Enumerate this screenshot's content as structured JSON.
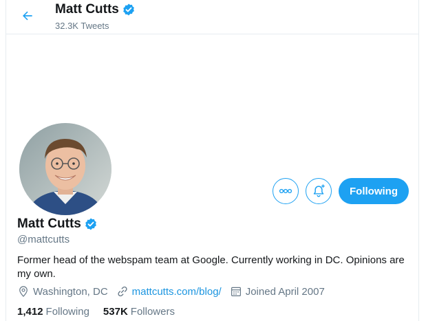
{
  "header": {
    "back_icon": "arrow-left-icon",
    "name": "Matt Cutts",
    "tweet_count": "32.3K Tweets"
  },
  "profile": {
    "name": "Matt Cutts",
    "handle": "@mattcutts",
    "verified": true,
    "bio": "Former head of the webspam team at Google. Currently working in DC. Opinions are my own.",
    "location": "Washington, DC",
    "website": "mattcutts.com/blog/",
    "joined": "Joined April 2007"
  },
  "actions": {
    "more_icon": "more-options-icon",
    "notify_icon": "bell-plus-icon",
    "following_label": "Following"
  },
  "stats": {
    "following_count": "1,412",
    "following_label": "Following",
    "followers_count": "537K",
    "followers_label": "Followers"
  },
  "colors": {
    "accent": "#1da1f2",
    "link": "#1b95e0",
    "secondary_text": "#657786",
    "border": "#e6ecf0"
  }
}
